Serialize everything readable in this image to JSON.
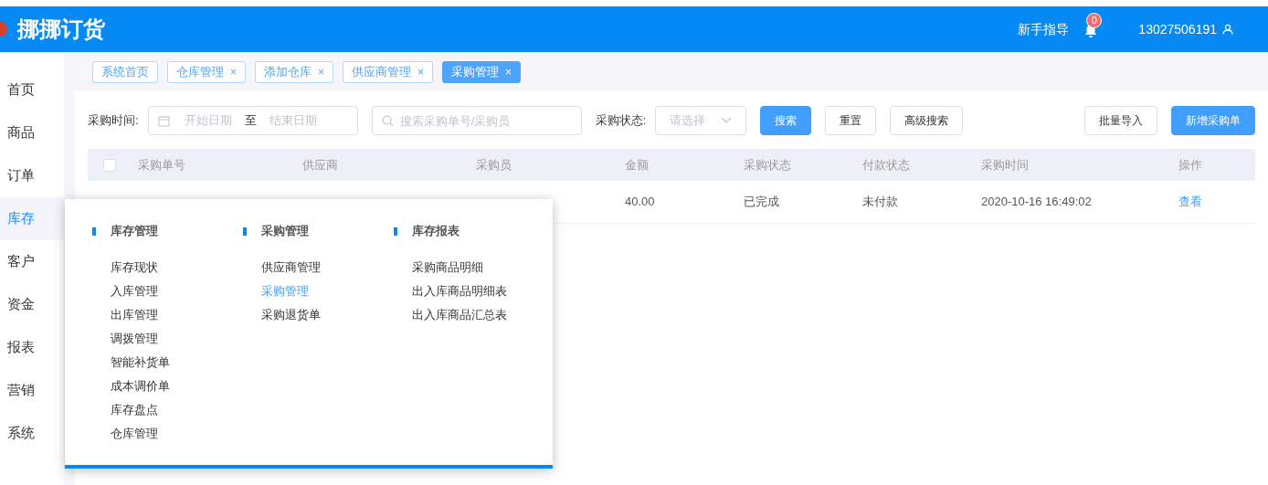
{
  "header": {
    "logo": "挪挪订货",
    "guide": "新手指导",
    "notification_count": "0",
    "user": "13027506191"
  },
  "sidebar": {
    "items": [
      {
        "label": "首页",
        "selected": false
      },
      {
        "label": "商品",
        "selected": false
      },
      {
        "label": "订单",
        "selected": false
      },
      {
        "label": "库存",
        "selected": true
      },
      {
        "label": "客户",
        "selected": false
      },
      {
        "label": "资金",
        "selected": false
      },
      {
        "label": "报表",
        "selected": false
      },
      {
        "label": "营销",
        "selected": false
      },
      {
        "label": "系统",
        "selected": false
      }
    ]
  },
  "tabs": [
    {
      "label": "系统首页",
      "selected": false
    },
    {
      "label": "仓库管理",
      "close": "×",
      "selected": false
    },
    {
      "label": "添加仓库",
      "close": "×",
      "selected": false
    },
    {
      "label": "供应商管理",
      "close": "×",
      "selected": false
    },
    {
      "label": "采购管理",
      "close": "×",
      "selected": true
    }
  ],
  "filters": {
    "time_label": "采购时间:",
    "start_placeholder": "开始日期",
    "separator": "至",
    "end_placeholder": "结束日期",
    "search_placeholder": "搜索采购单号/采购员",
    "status_label": "采购状态:",
    "status_placeholder": "请选择",
    "buttons": [
      {
        "label": "搜索",
        "kind": "primary"
      },
      {
        "label": "重置",
        "kind": "default"
      },
      {
        "label": "高级搜索",
        "kind": "default"
      }
    ],
    "right_buttons": [
      {
        "label": "批量导入",
        "kind": "default"
      },
      {
        "label": "新增采购单",
        "kind": "primary"
      }
    ]
  },
  "table": {
    "select_all_checked": false,
    "columns": [
      "采购单号",
      "供应商",
      "采购员",
      "金额",
      "采购状态",
      "付款状态",
      "采购时间",
      "操作"
    ],
    "rows": [
      {
        "amount": "40.00",
        "purchase_status": "已完成",
        "payment_status": "未付款",
        "time": "2020-10-16 16:49:02",
        "action": "查看"
      }
    ]
  },
  "menu": {
    "groups": [
      {
        "title": "库存管理",
        "items": [
          {
            "label": "库存现状",
            "selected": false
          },
          {
            "label": "入库管理",
            "selected": false
          },
          {
            "label": "出库管理",
            "selected": false
          },
          {
            "label": "调拨管理",
            "selected": false
          },
          {
            "label": "智能补货单",
            "selected": false
          },
          {
            "label": "成本调价单",
            "selected": false
          },
          {
            "label": "库存盘点",
            "selected": false
          },
          {
            "label": "仓库管理",
            "selected": false
          }
        ]
      },
      {
        "title": "采购管理",
        "items": [
          {
            "label": "供应商管理",
            "selected": false
          },
          {
            "label": "采购管理",
            "selected": true
          },
          {
            "label": "采购退货单",
            "selected": false
          }
        ]
      },
      {
        "title": "库存报表",
        "items": [
          {
            "label": "采购商品明细",
            "selected": false
          },
          {
            "label": "出入库商品明细表",
            "selected": false
          },
          {
            "label": "出入库商品汇总表",
            "selected": false
          }
        ]
      }
    ]
  }
}
